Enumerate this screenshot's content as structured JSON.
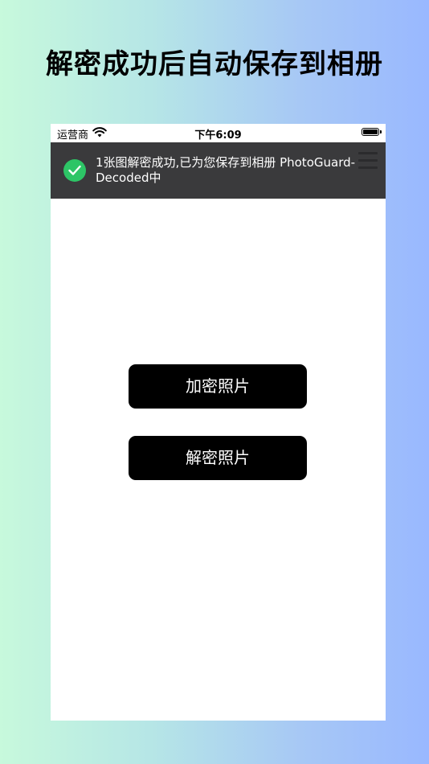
{
  "headline": "解密成功后自动保存到相册",
  "status_bar": {
    "carrier": "运营商",
    "time": "下午6:09"
  },
  "toast": {
    "message": "1张图解密成功,已为您保存到相册 PhotoGuard-Decoded中"
  },
  "buttons": {
    "encrypt_label": "加密照片",
    "decrypt_label": "解密照片"
  },
  "colors": {
    "toast_bg": "#3a3a3c",
    "success": "#2dc566",
    "button_bg": "#000000"
  }
}
